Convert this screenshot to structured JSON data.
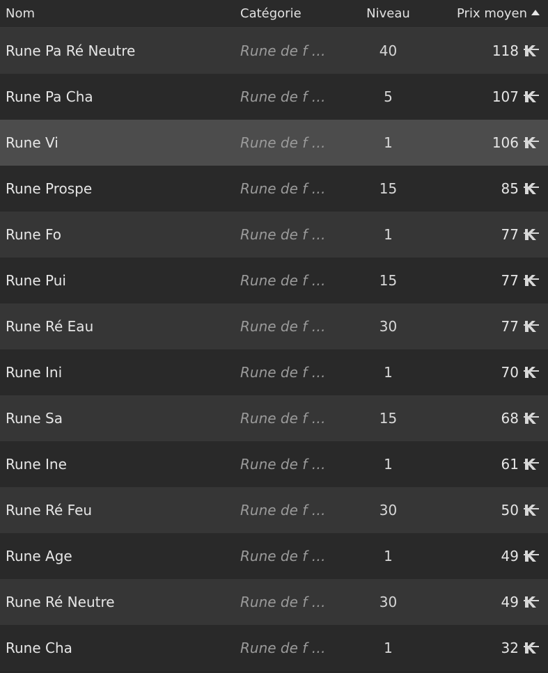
{
  "header": {
    "name_label": "Nom",
    "category_label": "Catégorie",
    "level_label": "Niveau",
    "price_label": "Prix moyen"
  },
  "currency_icon": "kama-icon",
  "sort": {
    "column": "price",
    "direction": "ascending-indicator"
  },
  "rows": [
    {
      "name": "Rune Pa Ré Neutre",
      "category": "Rune de f …",
      "level": "40",
      "price": "118"
    },
    {
      "name": "Rune Pa Cha",
      "category": "Rune de f …",
      "level": "5",
      "price": "107"
    },
    {
      "name": "Rune Vi",
      "category": "Rune de f …",
      "level": "1",
      "price": "106"
    },
    {
      "name": "Rune Prospe",
      "category": "Rune de f …",
      "level": "15",
      "price": "85"
    },
    {
      "name": "Rune Fo",
      "category": "Rune de f …",
      "level": "1",
      "price": "77"
    },
    {
      "name": "Rune Pui",
      "category": "Rune de f …",
      "level": "15",
      "price": "77"
    },
    {
      "name": "Rune Ré Eau",
      "category": "Rune de f …",
      "level": "30",
      "price": "77"
    },
    {
      "name": "Rune Ini",
      "category": "Rune de f …",
      "level": "1",
      "price": "70"
    },
    {
      "name": "Rune Sa",
      "category": "Rune de f …",
      "level": "15",
      "price": "68"
    },
    {
      "name": "Rune Ine",
      "category": "Rune de f …",
      "level": "1",
      "price": "61"
    },
    {
      "name": "Rune Ré Feu",
      "category": "Rune de f …",
      "level": "30",
      "price": "50"
    },
    {
      "name": "Rune Age",
      "category": "Rune de f …",
      "level": "1",
      "price": "49"
    },
    {
      "name": "Rune Ré Neutre",
      "category": "Rune de f …",
      "level": "30",
      "price": "49"
    },
    {
      "name": "Rune Cha",
      "category": "Rune de f …",
      "level": "1",
      "price": "32"
    }
  ]
}
